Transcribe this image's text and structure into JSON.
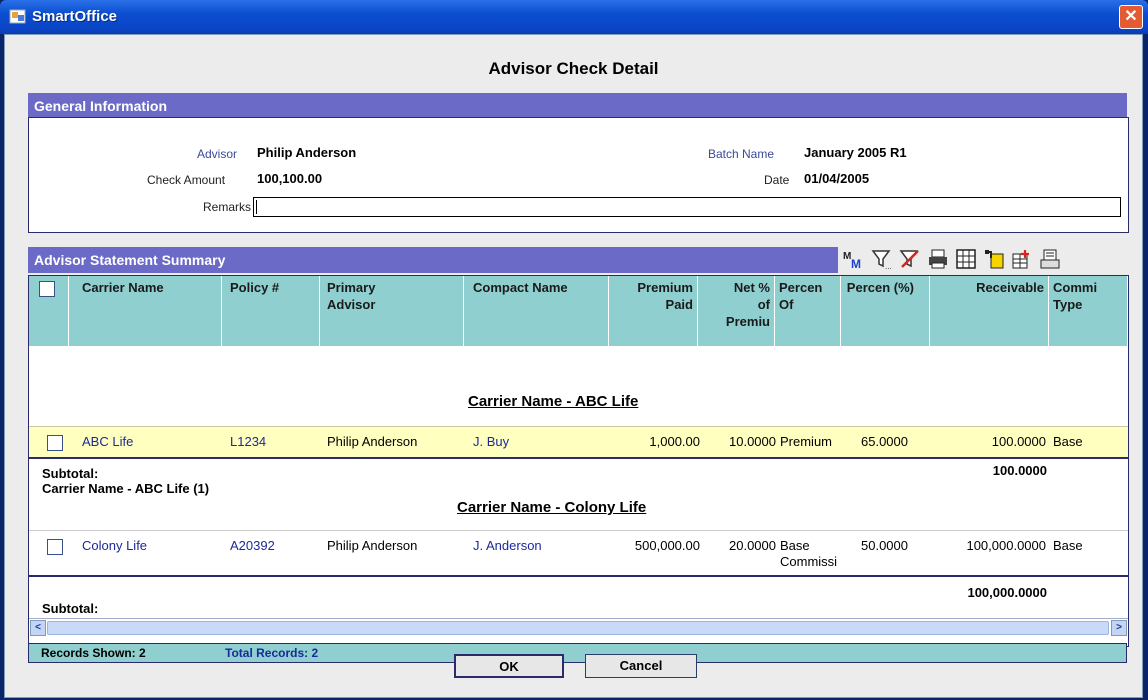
{
  "window": {
    "title": "SmartOffice",
    "close_glyph": "✕"
  },
  "page_title": "Advisor Check Detail",
  "general": {
    "header": "General Information",
    "advisor_label": "Advisor",
    "advisor_value": "Philip Anderson",
    "check_amount_label": "Check Amount",
    "check_amount_value": "100,100.00",
    "remarks_label": "Remarks",
    "remarks_value": "",
    "batch_name_label": "Batch Name",
    "batch_name_value": "January 2005 R1",
    "date_label": "Date",
    "date_value": "01/04/2005"
  },
  "summary": {
    "header": "Advisor Statement Summary",
    "toolbar_icons": [
      "multi-sort-icon",
      "filter-icon",
      "clear-filter-icon",
      "print-icon",
      "grid-icon",
      "export-icon",
      "add-column-icon",
      "print-preview-icon"
    ],
    "columns": {
      "carrier": "Carrier Name",
      "policy": "Policy #",
      "primary_advisor": "Primary Advisor",
      "compact_name": "Compact Name",
      "premium_paid": "Premium Paid",
      "net_pct": "Net % of Premiu",
      "percent_of": "Percen Of",
      "percent": "Percen (%)",
      "receivable": "Receivable",
      "commission_type": "Commi Type"
    },
    "groups": [
      {
        "label": "Carrier Name - ABC Life",
        "row": {
          "carrier": "ABC Life",
          "policy": "L1234",
          "primary_advisor": "Philip Anderson",
          "compact_name": "J. Buy",
          "premium_paid": "1,000.00",
          "net_pct": "10.0000",
          "percent_of": "Premium",
          "percent": "65.0000",
          "receivable": "100.0000",
          "commission_type": "Base"
        },
        "subtotal_label": "Subtotal:",
        "subtotal_group": "Carrier Name - ABC Life (1)",
        "subtotal_value": "100.0000"
      },
      {
        "label": "Carrier Name - Colony Life",
        "row": {
          "carrier": "Colony Life",
          "policy": "A20392",
          "primary_advisor": "Philip Anderson",
          "compact_name": "J. Anderson",
          "premium_paid": "500,000.00",
          "net_pct": "20.0000",
          "percent_of_1": "Base",
          "percent_of_2": "Commissi",
          "percent": "50.0000",
          "receivable": "100,000.0000",
          "commission_type": "Base"
        },
        "subtotal_label": "Subtotal:",
        "subtotal_value": "100,000.0000"
      }
    ],
    "records_shown": "Records Shown: 2",
    "total_records": "Total Records: 2"
  },
  "buttons": {
    "ok": "OK",
    "cancel": "Cancel"
  },
  "colors": {
    "section_header": "#6b6bc7",
    "grid_header": "#8fcfcf",
    "highlight_row": "#ffffc0",
    "link": "#1a2a9a"
  }
}
